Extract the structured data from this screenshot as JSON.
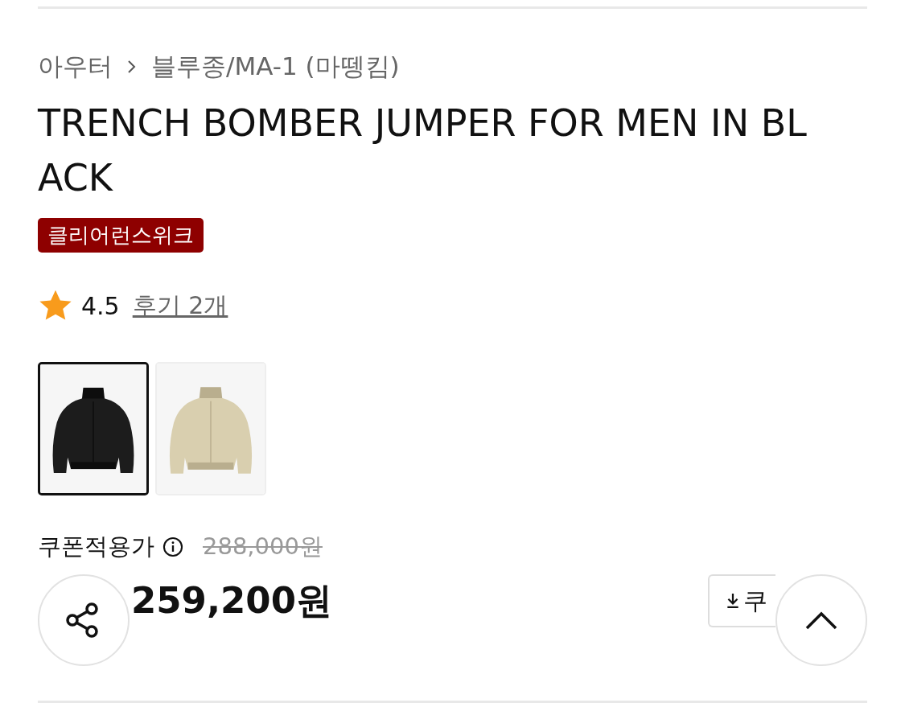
{
  "breadcrumb": [
    "아우터",
    "블루종/MA-1 (마뗑킴)"
  ],
  "title": "TRENCH BOMBER JUMPER FOR MEN IN BLACK",
  "badge": "클리어런스위크",
  "rating": {
    "score": "4.5",
    "reviews": "후기 2개"
  },
  "thumbnails": [
    {
      "kind": "picture",
      "selected": true
    },
    {
      "kind": "picture",
      "selected": false
    }
  ],
  "price": {
    "label": "쿠폰적용가",
    "original": "288,000원",
    "final": "259,200원",
    "coupon_button": "쿠"
  }
}
